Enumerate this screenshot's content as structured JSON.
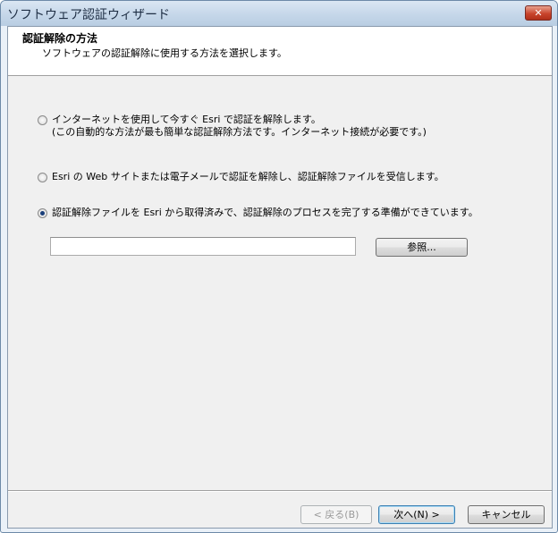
{
  "window": {
    "title": "ソフトウェア認証ウィザード",
    "close_glyph": "✕"
  },
  "header": {
    "title": "認証解除の方法",
    "subtitle": "ソフトウェアの認証解除に使用する方法を選択します。"
  },
  "options": [
    {
      "line1": "インターネットを使用して今すぐ Esri で認証を解除します。",
      "line2": "(この自動的な方法が最も簡単な認証解除方法です。インターネット接続が必要です。)",
      "selected": false
    },
    {
      "line1": "Esri の Web サイトまたは電子メールで認証を解除し、認証解除ファイルを受信します。",
      "selected": false
    },
    {
      "line1": "認証解除ファイルを Esri から取得済みで、認証解除のプロセスを完了する準備ができています。",
      "selected": true
    }
  ],
  "file_path": {
    "value": ""
  },
  "buttons": {
    "browse": "参照...",
    "back": "< 戻る(B)",
    "next": "次へ(N) >",
    "cancel": "キャンセル"
  }
}
